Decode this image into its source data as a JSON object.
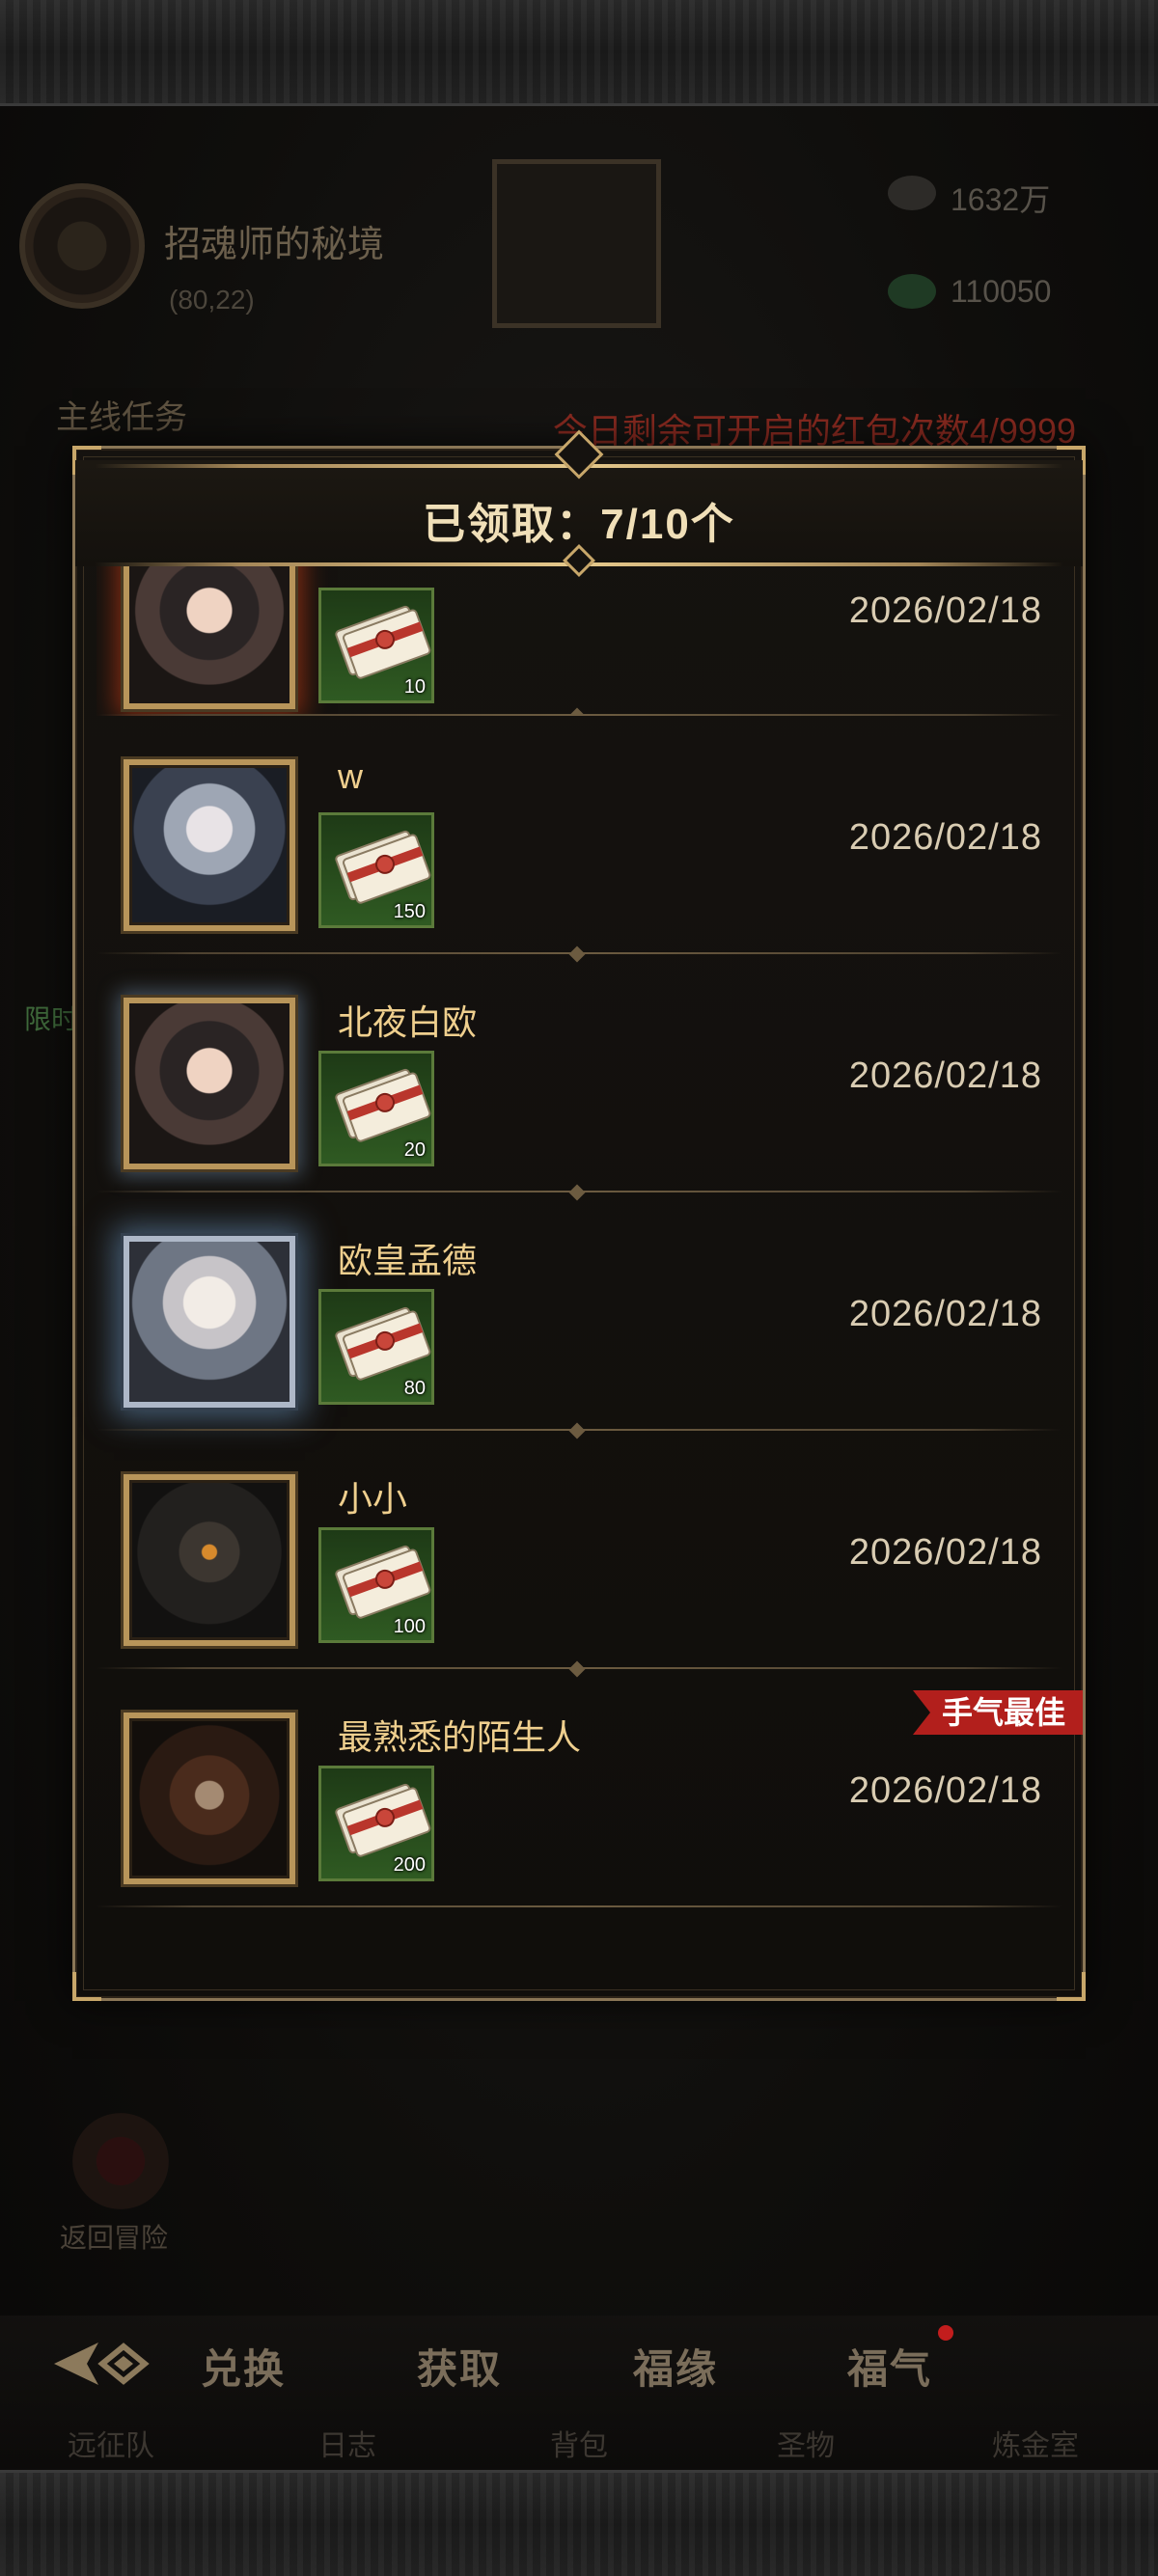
{
  "background": {
    "location_title": "招魂师的秘境",
    "location_coords": "(80,22)",
    "currency_1": "1632万",
    "currency_2": "110050",
    "quest_title": "主线任务",
    "redpacket_remaining": "今日剩余可开启的红包次数4/9999",
    "left_label": "限时",
    "return_label": "返回冒险"
  },
  "bottom_nav": {
    "tabs": [
      "兑换",
      "获取",
      "福缘",
      "福气"
    ],
    "sub_labels": [
      "远征队",
      "日志",
      "背包",
      "圣物",
      "炼金室"
    ]
  },
  "panel": {
    "title": "已领取：7/10个",
    "best_luck_label": "手气最佳",
    "records": [
      {
        "name": "",
        "count": "10",
        "date": "2026/02/18"
      },
      {
        "name": "w",
        "count": "150",
        "date": "2026/02/18"
      },
      {
        "name": "北夜白欧",
        "count": "20",
        "date": "2026/02/18"
      },
      {
        "name": "欧皇孟德",
        "count": "80",
        "date": "2026/02/18"
      },
      {
        "name": "小小",
        "count": "100",
        "date": "2026/02/18"
      },
      {
        "name": "最熟悉的陌生人",
        "count": "200",
        "date": "2026/02/18"
      }
    ]
  },
  "icons": {
    "reward": "red-ticket-bundle-icon",
    "back": "back-arrow-icon"
  },
  "colors": {
    "accent_gold": "#c8a76a",
    "name_gold": "#efcf8e",
    "best_luck_red": "#b21f1c",
    "item_bg_green": "#2f5a22"
  }
}
